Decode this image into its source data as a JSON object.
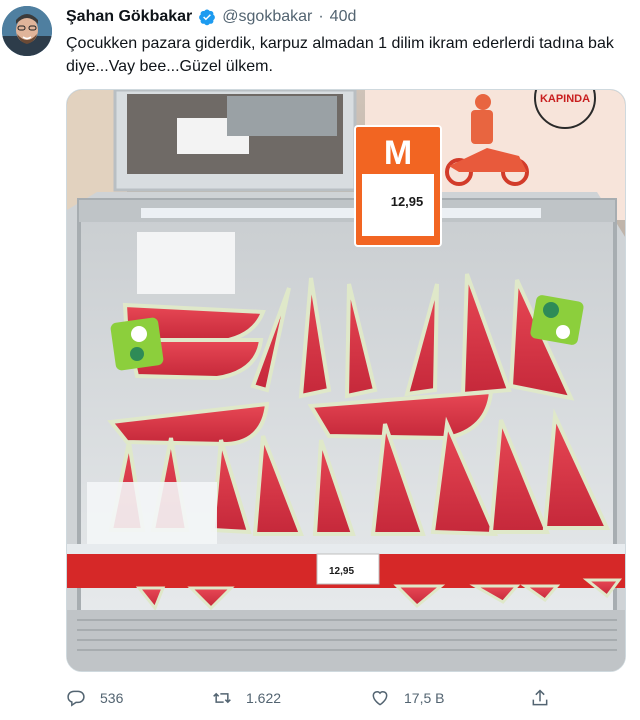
{
  "tweet": {
    "display_name": "Şahan Gökbakar",
    "handle": "@sgokbakar",
    "separator": "·",
    "age": "40d",
    "text": "Çocukken pazara giderdik, karpuz almadan 1 dilim ikram ederlerdi tadına bak diye...Vay bee...Güzel ülkem."
  },
  "photo": {
    "price_sign_letter": "M",
    "price_sign_price": "12,95",
    "shelf_price": "12,95",
    "banner_text": "KAPINDA"
  },
  "actions": {
    "reply_count": "536",
    "retweet_count": "1.622",
    "like_count": "17,5 B"
  },
  "colors": {
    "accent": "#1d9bf0",
    "migros_orange": "#f26522",
    "watermelon": "#e63946"
  },
  "icons": {
    "verified": "verified-badge-icon",
    "reply": "reply-icon",
    "retweet": "retweet-icon",
    "like": "heart-icon",
    "share": "share-icon"
  }
}
